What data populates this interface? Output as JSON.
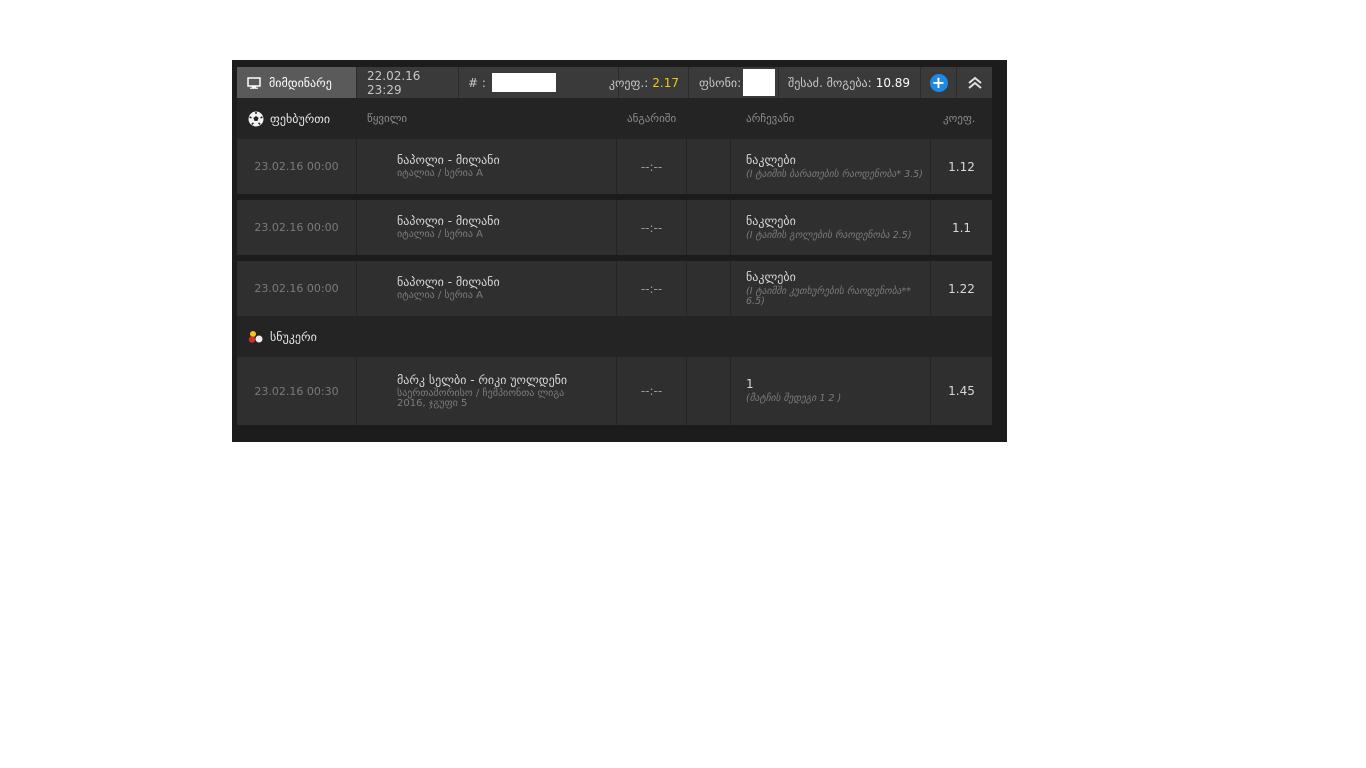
{
  "topbar": {
    "status_label": "მიმდინარე",
    "datetime": "22.02.16 23:29",
    "number_label": "# :",
    "coef_label": "კოეფ.:",
    "coef_value": "2.17",
    "stake_label": "ფსონი:",
    "win_label": "შესაძ. მოგება:",
    "win_value": "10.89"
  },
  "groups": [
    {
      "sport": "ფეხბურთი",
      "icon": "soccer-ball-icon",
      "columns": {
        "event": "წყვილი",
        "score": "ანგარიში",
        "pick": "არჩევანი",
        "odd": "კოეფ."
      },
      "rows": [
        {
          "date": "23.02.16 00:00",
          "event": "ნაპოლი - მილანი",
          "league": "იტალია / სერია A",
          "score": "--:--",
          "pick": "ნაკლები",
          "pick_sub": "(I ტაიმის ბარათების რაოდენობა* 3.5)",
          "odd": "1.12"
        },
        {
          "date": "23.02.16 00:00",
          "event": "ნაპოლი - მილანი",
          "league": "იტალია / სერია A",
          "score": "--:--",
          "pick": "ნაკლები",
          "pick_sub": "(I ტაიმის გოლების რაოდენობა 2.5)",
          "odd": "1.1"
        },
        {
          "date": "23.02.16 00:00",
          "event": "ნაპოლი - მილანი",
          "league": "იტალია / სერია A",
          "score": "--:--",
          "pick": "ნაკლები",
          "pick_sub": "(I ტაიმში კუთხურების რაოდენობა** 6.5)",
          "odd": "1.22"
        }
      ]
    },
    {
      "sport": "სნუკერი",
      "icon": "snooker-balls-icon",
      "rows": [
        {
          "date": "23.02.16 00:30",
          "event": "მარკ სელბი - რიკი უოლდენი",
          "league": "საერთაშორისო / ჩემპიონთა ლიგა 2016, ჯგუფი 5",
          "score": "--:--",
          "pick": "1",
          "pick_sub": "(მატჩის შედეგი 1 2 )",
          "odd": "1.45"
        }
      ]
    }
  ]
}
